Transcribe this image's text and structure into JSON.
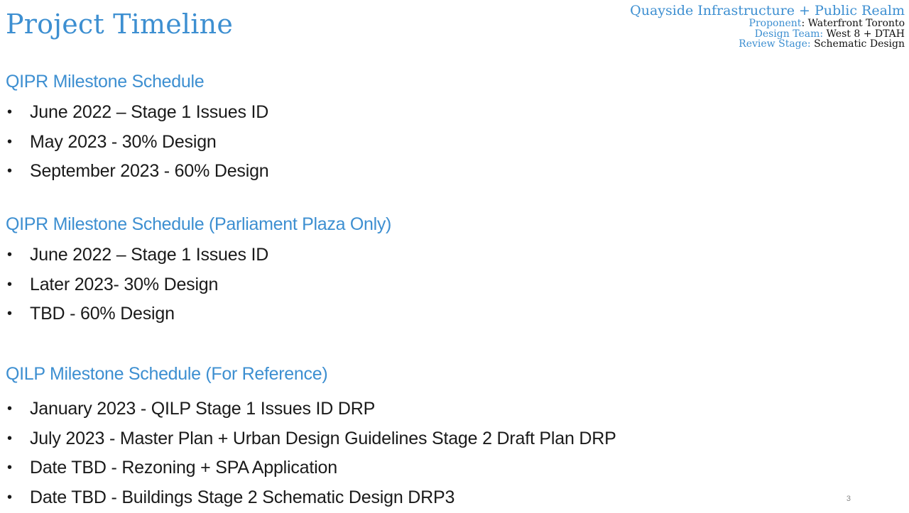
{
  "title": "Project Timeline",
  "project": {
    "name": "Quayside Infrastructure + Public Realm",
    "proponent_label": "Proponent",
    "proponent_value": "Waterfront Toronto",
    "design_team_label": "Design Team:",
    "design_team_value": "West 8 + DTAH",
    "review_stage_label": "Review Stage:",
    "review_stage_value": "Schematic Design"
  },
  "sections": [
    {
      "heading": "QIPR Milestone Schedule",
      "items": [
        "June 2022 – Stage 1 Issues ID",
        "May 2023 - 30% Design",
        "September 2023 - 60% Design"
      ]
    },
    {
      "heading": "QIPR Milestone Schedule (Parliament Plaza Only)",
      "items": [
        "June 2022 – Stage 1 Issues ID",
        "Later 2023- 30% Design",
        "TBD - 60% Design"
      ]
    },
    {
      "heading": "QILP Milestone Schedule  (For Reference)",
      "items": [
        "January 2023 - QILP Stage 1 Issues ID DRP",
        "July 2023 - Master Plan + Urban Design Guidelines Stage 2 Draft Plan DRP",
        "Date TBD - Rezoning + SPA Application",
        "Date TBD - Buildings Stage 2 Schematic Design DRP3"
      ]
    }
  ],
  "bullet_glyph": "•",
  "page_number": "3",
  "colors": {
    "accent": "#3d8fd1",
    "text": "#1a1a1a",
    "background": "#ffffff"
  }
}
